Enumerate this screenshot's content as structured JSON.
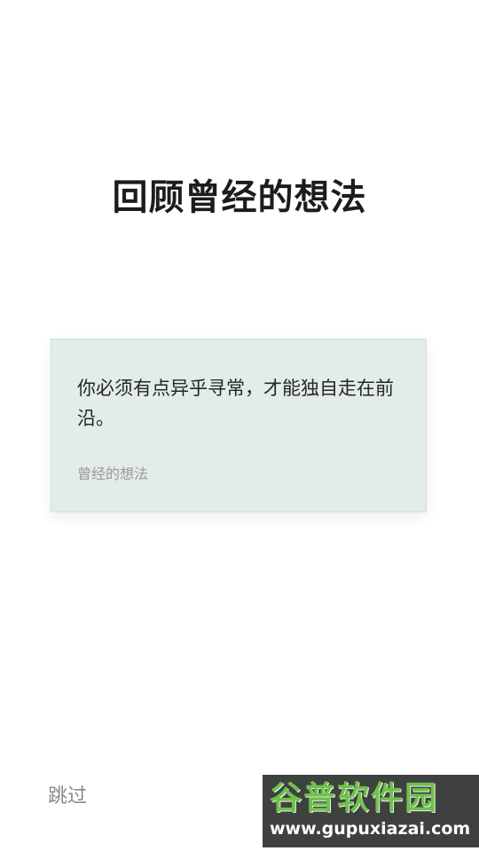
{
  "title": "回顾曾经的想法",
  "card": {
    "quote": "你必须有点异乎寻常，才能独自走在前沿。",
    "source": "曾经的想法"
  },
  "skip_label": "跳过",
  "watermark": {
    "chinese": "谷普软件园",
    "url": "www.gupuxiazai.com"
  },
  "colors": {
    "card_background": "#e2ecea",
    "title": "#1c1c1c",
    "skip": "#8a8a8a",
    "watermark_green": "#6fc04d"
  }
}
